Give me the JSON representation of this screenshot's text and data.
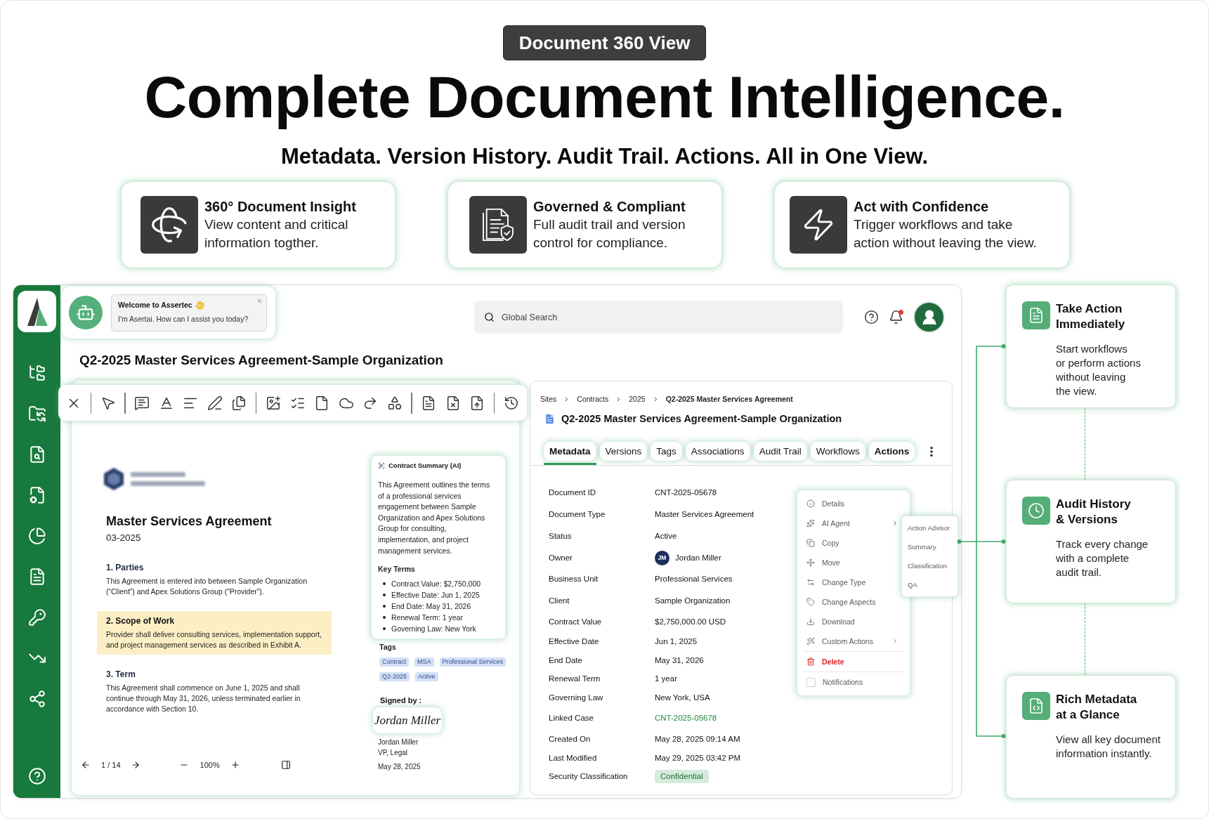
{
  "header": {
    "badge": "Document 360 View",
    "title": "Complete Document Intelligence.",
    "subtitle": "Metadata. Version History. Audit Trail. Actions. All in One View."
  },
  "features": [
    {
      "title": "360° Document Insight",
      "description": "View content and critical\ninformation togther."
    },
    {
      "title": "Governed & Compliant",
      "description": "Full audit trail and version\ncontrol for compliance."
    },
    {
      "title": "Act with Confidence",
      "description": "Trigger workflows and take\naction without leaving the view."
    }
  ],
  "app": {
    "chat": {
      "title": "Welcome to Assertec",
      "message": "I'm Asertai. How can I assist you today?"
    },
    "search": {
      "placeholder": "Global Search"
    },
    "notifications": {
      "unread": true
    },
    "page_title": "Q2-2025 Master Services Agreement-Sample Organization",
    "viewer": {
      "document_title": "Master Services Agreement",
      "document_date": "03-2025",
      "sections": [
        {
          "heading": "1. Parties",
          "body": "This Agreement is entered into between Sample Organization (“Client”) and Apex Solutions Group (“Provider”).",
          "highlighted": false
        },
        {
          "heading": "2. Scope of Work",
          "body": "Provider shall deliver consulting services, implementation support, and project management services as described in Exhibit A.",
          "highlighted": true
        },
        {
          "heading": "3. Term",
          "body": "This Agreement shall commence on June 1, 2025 and shall continue through May 31, 2026, unless terminated earlier in accordance with Section 10.",
          "highlighted": false
        }
      ],
      "pager": {
        "page": "1 / 14",
        "zoom": "100%"
      },
      "summary": {
        "title": "Contract Summary (AI)",
        "body": "This Agreement outlines the terms of a professional services engagement between Sample Organization and Apex Solutions Group for consulting, implementation, and project management services.",
        "key_terms_heading": "Key Terms",
        "key_terms": [
          "Contract Value: $2,750,000",
          "Effective Date: Jun 1, 2025",
          "End Date: May 31, 2026",
          "Renewal Term: 1 year",
          "Governing Law: New York"
        ]
      },
      "tags": {
        "label": "Tags",
        "items": [
          "Contract",
          "MSA",
          "Professional Services",
          "Q2-2025",
          "Active"
        ]
      },
      "signature": {
        "label": "Signed by :",
        "signature": "Jordan Miller",
        "name": "Jordan Miller",
        "role": "VP, Legal",
        "date": "May 28, 2025"
      }
    },
    "details": {
      "breadcrumb": [
        "Sites",
        "Contracts",
        "2025",
        "Q2-2025 Master Services Agreement"
      ],
      "title": "Q2-2025 Master Services Agreement-Sample Organization",
      "tabs": [
        {
          "label": "Metadata",
          "selected": true,
          "menu_open": false
        },
        {
          "label": "Versions",
          "selected": false,
          "menu_open": false
        },
        {
          "label": "Tags",
          "selected": false,
          "menu_open": false
        },
        {
          "label": "Associations",
          "selected": false,
          "menu_open": false
        },
        {
          "label": "Audit Trail",
          "selected": false,
          "menu_open": false
        },
        {
          "label": "Workflows",
          "selected": false,
          "menu_open": false
        },
        {
          "label": "Actions",
          "selected": false,
          "menu_open": true
        }
      ],
      "fields": [
        {
          "label": "Document ID",
          "value": "CNT-2025-05678",
          "kind": "text"
        },
        {
          "label": "Document Type",
          "value": "Master Services Agreement",
          "kind": "text"
        },
        {
          "label": "Status",
          "value": "Active",
          "kind": "text"
        },
        {
          "label": "Owner",
          "value": "Jordan Miller",
          "kind": "person",
          "initials": "JM"
        },
        {
          "label": "Business Unit",
          "value": "Professional Services",
          "kind": "text"
        },
        {
          "label": "Client",
          "value": "Sample Organization",
          "kind": "text"
        },
        {
          "label": "Contract Value",
          "value": "$2,750,000.00 USD",
          "kind": "text"
        },
        {
          "label": "Effective Date",
          "value": "Jun 1, 2025",
          "kind": "text"
        },
        {
          "label": "End Date",
          "value": "May 31, 2026",
          "kind": "text"
        },
        {
          "label": "Renewal Term",
          "value": "1 year",
          "kind": "text"
        },
        {
          "label": "Governing Law",
          "value": "New York, USA",
          "kind": "text"
        },
        {
          "label": "Linked Case",
          "value": "CNT-2025-05678",
          "kind": "link"
        },
        {
          "label": "Created On",
          "value": "May 28, 2025 09:14 AM",
          "kind": "text"
        },
        {
          "label": "Last Modified",
          "value": "May 29, 2025 03:42 PM",
          "kind": "text"
        },
        {
          "label": "Security Classification",
          "value": "Confidential",
          "kind": "badge"
        }
      ],
      "menu": {
        "groups": [
          [
            {
              "label": "Details",
              "kind": "item"
            },
            {
              "label": "AI Agent",
              "kind": "submenu",
              "expanded": true
            },
            {
              "label": "Copy",
              "kind": "item"
            },
            {
              "label": "Move",
              "kind": "item"
            },
            {
              "label": "Change Type",
              "kind": "item"
            },
            {
              "label": "Change Aspects",
              "kind": "item"
            },
            {
              "label": "Download",
              "kind": "item"
            },
            {
              "label": "Custom Actions",
              "kind": "submenu",
              "expanded": false
            }
          ],
          [
            {
              "label": "Delete",
              "kind": "danger"
            }
          ],
          [
            {
              "label": "Notifications",
              "kind": "checkbox",
              "checked": false
            }
          ]
        ],
        "submenu": [
          "Action Advisor",
          "Summary",
          "Classification",
          "QA"
        ]
      }
    }
  },
  "callouts": [
    {
      "title": "Take Action\nImmediately",
      "description": "Start workflows\nor perform actions\nwithout leaving\nthe view."
    },
    {
      "title": "Audit History\n& Versions",
      "description": "Track every change\nwith a complete\naudit trail."
    },
    {
      "title": "Rich Metadata\nat a Glance",
      "description": "View all key document\ninformation instantly."
    }
  ]
}
